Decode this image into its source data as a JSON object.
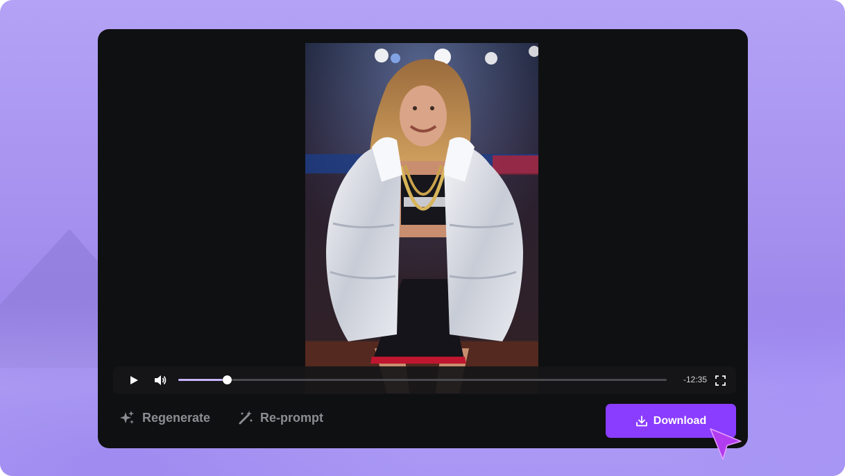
{
  "player": {
    "play_icon": "play-icon",
    "volume_icon": "volume-icon",
    "fullscreen_icon": "fullscreen-icon",
    "progress": 0.1,
    "time_remaining": "-12:35"
  },
  "actions": {
    "regenerate_label": "Regenerate",
    "regenerate_icon": "sparkles-icon",
    "reprompt_label": "Re-prompt",
    "reprompt_icon": "magic-wand-icon",
    "download_label": "Download",
    "download_icon": "download-icon"
  },
  "colors": {
    "accent": "#8a3dff",
    "progress_fill": "#c9b4ff",
    "card_bg": "#0f1011",
    "background": "#a893f0"
  }
}
